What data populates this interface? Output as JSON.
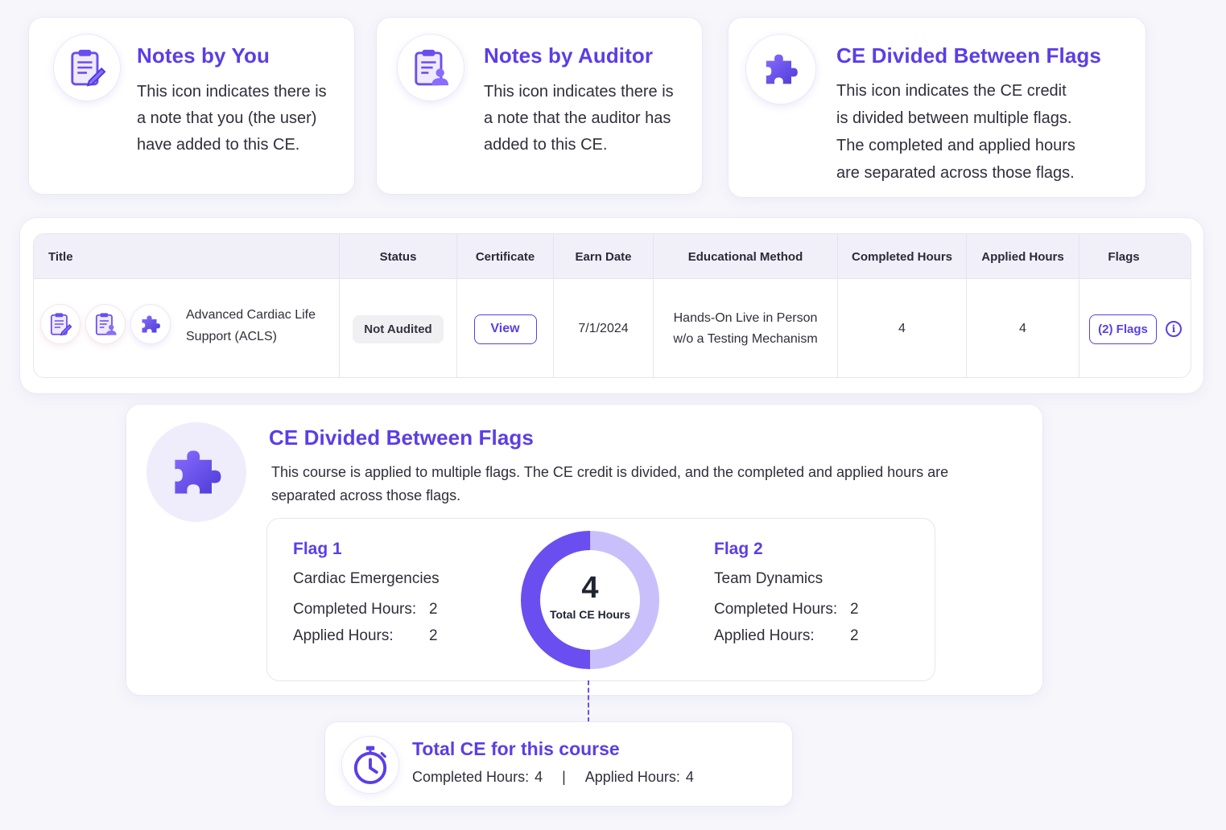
{
  "legend_cards": [
    {
      "icon": "clipboard-pencil-icon",
      "title": "Notes by You",
      "lines": [
        "This icon indicates there is",
        "a note that you (the user)",
        "have added to this CE."
      ]
    },
    {
      "icon": "clipboard-user-icon",
      "title": "Notes by Auditor",
      "lines": [
        "This icon indicates there is",
        "a note that the auditor has",
        "added to this CE."
      ]
    },
    {
      "icon": "puzzle-icon",
      "title": "CE Divided Between Flags",
      "lines": [
        "This icon indicates the CE credit",
        "is divided between multiple flags.",
        "The completed and applied hours",
        "are separated across those flags."
      ]
    }
  ],
  "table": {
    "headers": [
      "Title",
      "Status",
      "Certificate",
      "Earn Date",
      "Educational Method",
      "Completed Hours",
      "Applied Hours",
      "Flags"
    ],
    "row": {
      "title_line1": "Advanced Cardiac Life",
      "title_line2": "Support (ACLS)",
      "status": "Not Audited",
      "certificate_button": "View",
      "earn_date": "7/1/2024",
      "method_line1": "Hands-On Live in Person",
      "method_line2": "w/o a Testing Mechanism",
      "completed_hours": "4",
      "applied_hours": "4",
      "flags_button": "(2) Flags"
    }
  },
  "detail": {
    "title": "CE Divided Between Flags",
    "desc_line1": "This course is applied to multiple flags. The CE credit is divided, and the completed and applied hours are",
    "desc_line2": "separated across those flags.",
    "flag1": {
      "title": "Flag 1",
      "name": "Cardiac Emergencies",
      "completed_label": "Completed Hours:",
      "completed_value": "2",
      "applied_label": "Applied Hours:",
      "applied_value": "2"
    },
    "flag2": {
      "title": "Flag 2",
      "name": "Team Dynamics",
      "completed_label": "Completed Hours:",
      "completed_value": "2",
      "applied_label": "Applied Hours:",
      "applied_value": "2"
    },
    "donut": {
      "total": "4",
      "label": "Total CE Hours",
      "share_flag1": 0.5,
      "share_flag2": 0.5,
      "color_flag1": "#6b4ef0",
      "color_flag2": "#c9c0fb"
    }
  },
  "total_card": {
    "title": "Total CE for this course",
    "completed_label": "Completed Hours:",
    "completed_value": "4",
    "separator": "|",
    "applied_label": "Applied Hours:",
    "applied_value": "4"
  },
  "colors": {
    "accent": "#5b3ee6",
    "accent_light": "#c9c0fb",
    "background": "#f6f6fb"
  }
}
